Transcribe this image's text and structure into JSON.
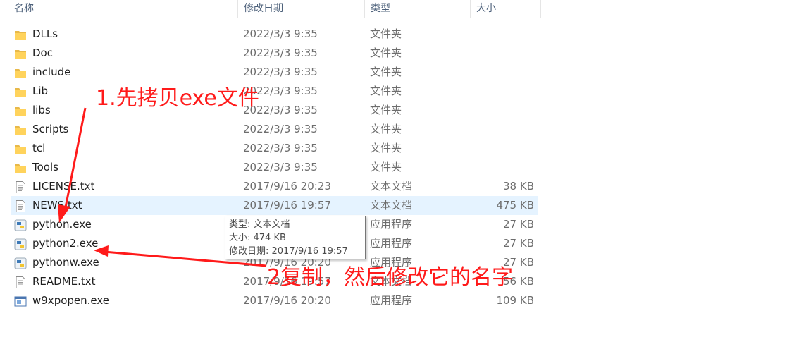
{
  "columns": {
    "name": "名称",
    "date": "修改日期",
    "type": "类型",
    "size": "大小"
  },
  "files": [
    {
      "icon": "folder-icon",
      "name": "DLLs",
      "date": "2022/3/3 9:35",
      "type": "文件夹",
      "size": ""
    },
    {
      "icon": "folder-icon",
      "name": "Doc",
      "date": "2022/3/3 9:35",
      "type": "文件夹",
      "size": ""
    },
    {
      "icon": "folder-icon",
      "name": "include",
      "date": "2022/3/3 9:35",
      "type": "文件夹",
      "size": ""
    },
    {
      "icon": "folder-icon",
      "name": "Lib",
      "date": "2022/3/3 9:35",
      "type": "文件夹",
      "size": ""
    },
    {
      "icon": "folder-icon",
      "name": "libs",
      "date": "2022/3/3 9:35",
      "type": "文件夹",
      "size": ""
    },
    {
      "icon": "folder-icon",
      "name": "Scripts",
      "date": "2022/3/3 9:35",
      "type": "文件夹",
      "size": ""
    },
    {
      "icon": "folder-icon",
      "name": "tcl",
      "date": "2022/3/3 9:35",
      "type": "文件夹",
      "size": ""
    },
    {
      "icon": "folder-icon",
      "name": "Tools",
      "date": "2022/3/3 9:35",
      "type": "文件夹",
      "size": ""
    },
    {
      "icon": "text-file-icon",
      "name": "LICENSE.txt",
      "date": "2017/9/16 20:23",
      "type": "文本文档",
      "size": "38 KB"
    },
    {
      "icon": "text-file-icon",
      "name": "NEWS.txt",
      "date": "2017/9/16 19:57",
      "type": "文本文档",
      "size": "475 KB"
    },
    {
      "icon": "python-exe-icon",
      "name": "python.exe",
      "date": "",
      "type": "应用程序",
      "size": "27 KB"
    },
    {
      "icon": "python-exe-icon",
      "name": "python2.exe",
      "date": "",
      "type": "应用程序",
      "size": "27 KB"
    },
    {
      "icon": "python-exe-icon",
      "name": "pythonw.exe",
      "date": "2017/9/16 20:20",
      "type": "应用程序",
      "size": "27 KB"
    },
    {
      "icon": "text-file-icon",
      "name": "README.txt",
      "date": "2017/9/16 19:57",
      "type": "文本文档",
      "size": "56 KB"
    },
    {
      "icon": "window-exe-icon",
      "name": "w9xpopen.exe",
      "date": "2017/9/16 20:20",
      "type": "应用程序",
      "size": "109 KB"
    }
  ],
  "tooltip": {
    "type_line": "类型: 文本文档",
    "size_line": "大小: 474 KB",
    "date_line": "修改日期: 2017/9/16 19:57"
  },
  "annotations": {
    "step1": "1.先拷贝exe文件",
    "step2": "2复制，然后修改它的名字"
  },
  "colors": {
    "annotation": "#ff1a1a",
    "hover_row": "#e5f3ff",
    "header_text": "#4c607a"
  }
}
